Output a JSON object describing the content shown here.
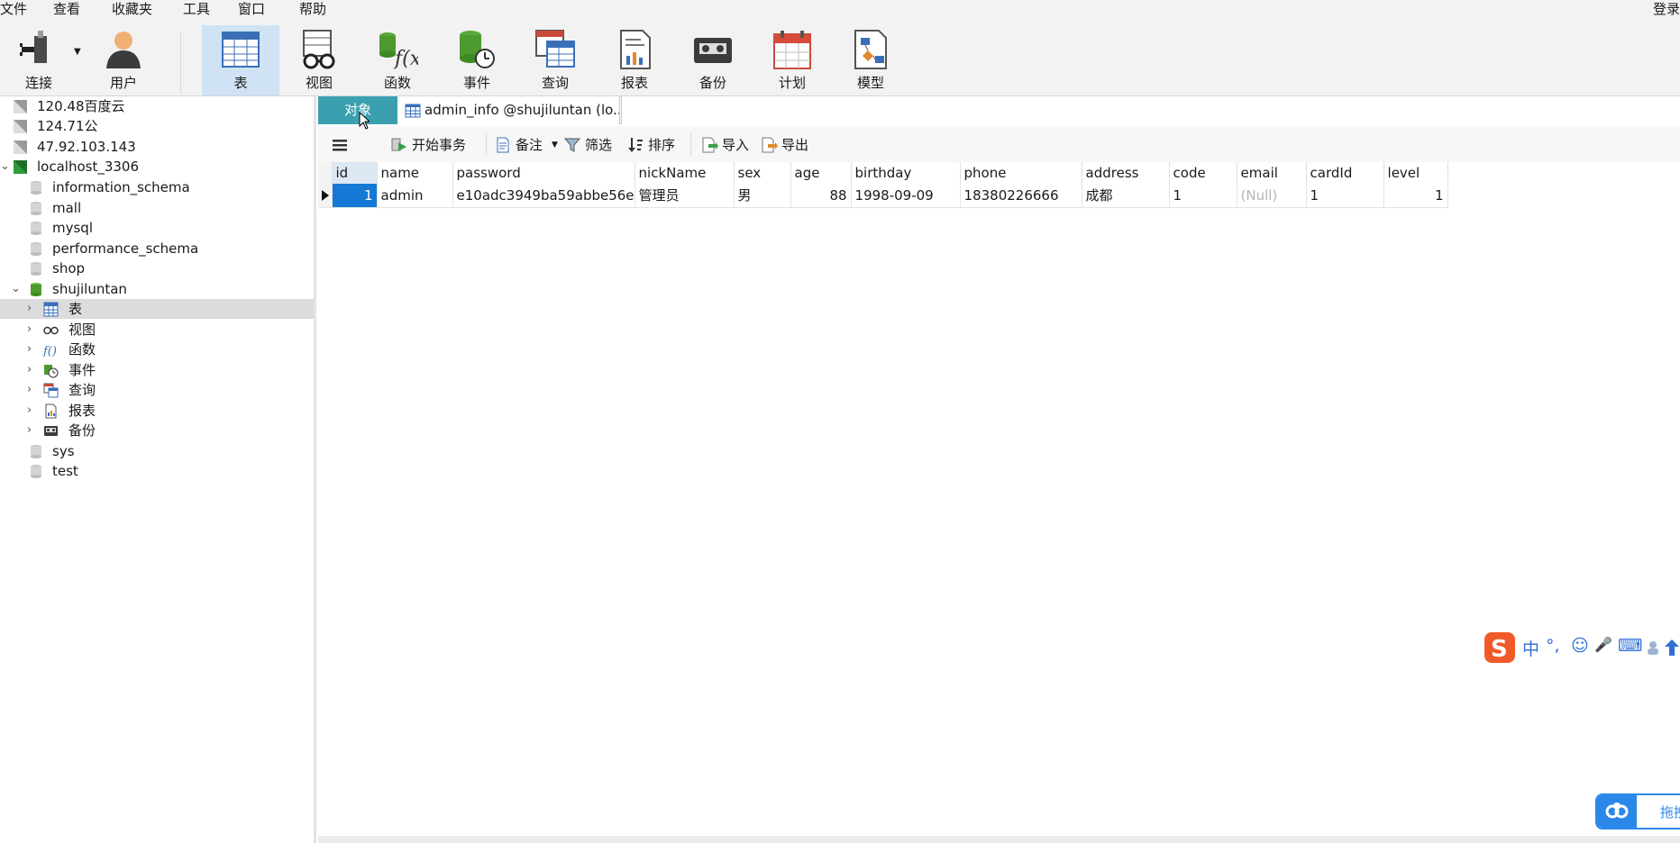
{
  "menu": {
    "items": [
      "文件",
      "查看",
      "收藏夹",
      "工具",
      "窗口",
      "帮助"
    ],
    "login": "登录"
  },
  "toolbar": {
    "buttons": [
      {
        "label": "连接",
        "icon": "plug-connect-icon"
      },
      {
        "label": "用户",
        "icon": "user-icon"
      },
      {
        "label": "表",
        "icon": "table-icon"
      },
      {
        "label": "视图",
        "icon": "view-glasses-icon"
      },
      {
        "label": "函数",
        "icon": "function-icon"
      },
      {
        "label": "事件",
        "icon": "event-clock-icon"
      },
      {
        "label": "查询",
        "icon": "query-icon"
      },
      {
        "label": "报表",
        "icon": "report-icon"
      },
      {
        "label": "备份",
        "icon": "backup-tape-icon"
      },
      {
        "label": "计划",
        "icon": "schedule-calendar-icon"
      },
      {
        "label": "模型",
        "icon": "model-icon"
      }
    ],
    "active": "表"
  },
  "tree": {
    "connections": [
      {
        "label": "120.48百度云"
      },
      {
        "label": "124.71公"
      },
      {
        "label": "47.92.103.143"
      },
      {
        "label": "localhost_3306"
      }
    ],
    "databases_before": [
      "information_schema",
      "mall",
      "mysql",
      "performance_schema",
      "shop"
    ],
    "open_db": "shujiluntan",
    "db_children": [
      {
        "label": "表",
        "icon": "table-icon"
      },
      {
        "label": "视图",
        "icon": "view-glasses-icon"
      },
      {
        "label": "函数",
        "icon": "function-icon"
      },
      {
        "label": "事件",
        "icon": "event-clock-icon"
      },
      {
        "label": "查询",
        "icon": "query-icon"
      },
      {
        "label": "报表",
        "icon": "report-icon"
      },
      {
        "label": "备份",
        "icon": "backup-tape-icon"
      }
    ],
    "databases_after": [
      "sys",
      "test"
    ]
  },
  "tabs": {
    "objects": "对象",
    "table_tab": "admin_info @shujiluntan (lo..."
  },
  "objbar": {
    "begin_tx": "开始事务",
    "memo": "备注",
    "filter": "筛选",
    "sort": "排序",
    "import": "导入",
    "export": "导出"
  },
  "grid": {
    "columns": [
      "id",
      "name",
      "password",
      "nickName",
      "sex",
      "age",
      "birthday",
      "phone",
      "address",
      "code",
      "email",
      "cardId",
      "level"
    ],
    "rows": [
      [
        "1",
        "admin",
        "e10adc3949ba59abbe56e",
        "管理员",
        "男",
        "88",
        "1998-09-09",
        "18380226666",
        "成都",
        "1",
        "(Null)",
        "1",
        "1"
      ]
    ]
  },
  "ime": {
    "items": [
      "中",
      "°,",
      "☺",
      "🎤",
      "⌨"
    ]
  },
  "cloud_widget": {
    "label": "拖拽"
  },
  "colors": {
    "accent_tab": "#3aa0b0",
    "selection": "#1478d4",
    "toolbar_active": "#cfe3f4"
  }
}
